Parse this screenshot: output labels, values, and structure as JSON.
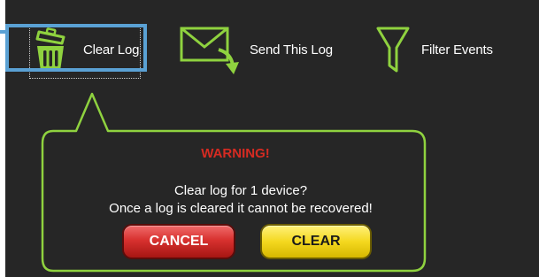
{
  "toolbar": {
    "clear_log_label": "Clear Log",
    "send_log_label": "Send This Log",
    "filter_events_label": "Filter Events"
  },
  "dialog": {
    "warning_title": "WARNING!",
    "message_line_1": "Clear log for 1 device?",
    "message_line_2": "Once a log is cleared it cannot be recovered!",
    "cancel_label": "CANCEL",
    "clear_label": "CLEAR"
  },
  "icons": {
    "clear_log": "trash-icon",
    "send_log": "envelope-icon",
    "filter_events": "funnel-icon"
  },
  "colors": {
    "background": "#262626",
    "accent_green": "#8fd23f",
    "warning_red": "#d62b22",
    "highlight_blue": "#5aa1d4",
    "cancel_red": "#d8312f",
    "clear_yellow": "#f4d81f"
  }
}
